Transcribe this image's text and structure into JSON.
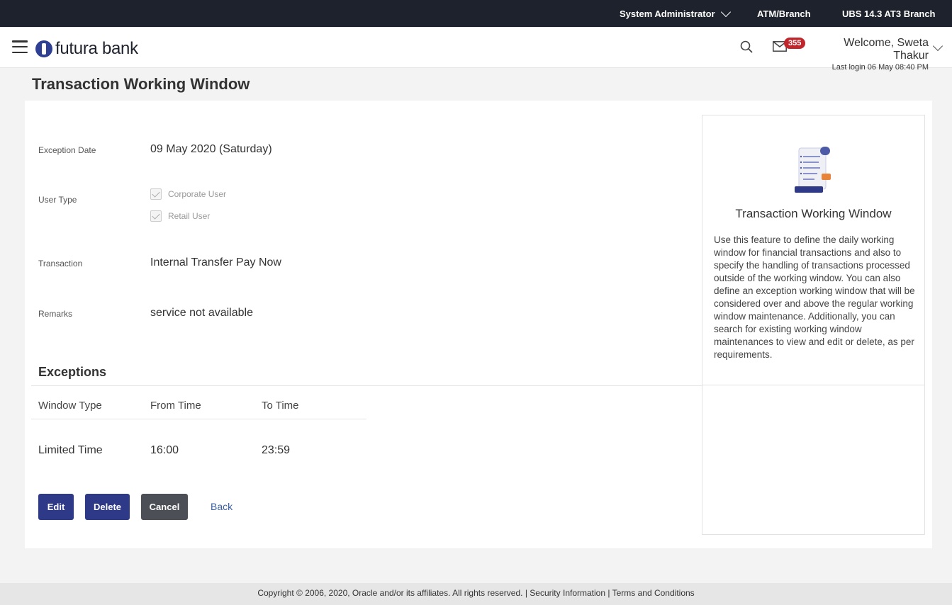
{
  "topbar": {
    "role": "System Administrator",
    "atm_branch": "ATM/Branch",
    "branch": "UBS 14.3 AT3 Branch"
  },
  "header": {
    "logo_text": "futura bank",
    "mail_count": "355",
    "welcome": "Welcome, Sweta Thakur",
    "last_login": "Last login 06 May 08:40 PM"
  },
  "page": {
    "title": "Transaction Working Window"
  },
  "form": {
    "exception_date_label": "Exception Date",
    "exception_date_value": "09 May 2020 (Saturday)",
    "user_type_label": "User Type",
    "user_types": [
      "Corporate User",
      "Retail User"
    ],
    "transaction_label": "Transaction",
    "transaction_value": "Internal Transfer Pay Now",
    "remarks_label": "Remarks",
    "remarks_value": "service not available"
  },
  "exceptions": {
    "title": "Exceptions",
    "columns": [
      "Window Type",
      "From Time",
      "To Time"
    ],
    "rows": [
      [
        "Limited Time",
        "16:00",
        "23:59"
      ]
    ]
  },
  "actions": {
    "edit": "Edit",
    "delete": "Delete",
    "cancel": "Cancel",
    "back": "Back"
  },
  "help": {
    "title": "Transaction Working Window",
    "text": "Use this feature to define the daily working window for financial transactions and also to specify the handling of transactions processed outside of the working window. You can also define an exception working window that will be considered over and above the regular working window maintenance. Additionally, you can search for existing working window maintenances to view and edit or delete, as per requirements."
  },
  "footer": {
    "copyright": "Copyright © 2006, 2020, Oracle and/or its affiliates. All rights reserved.",
    "separator": "|",
    "security": "Security Information",
    "terms": "Terms and Conditions"
  }
}
